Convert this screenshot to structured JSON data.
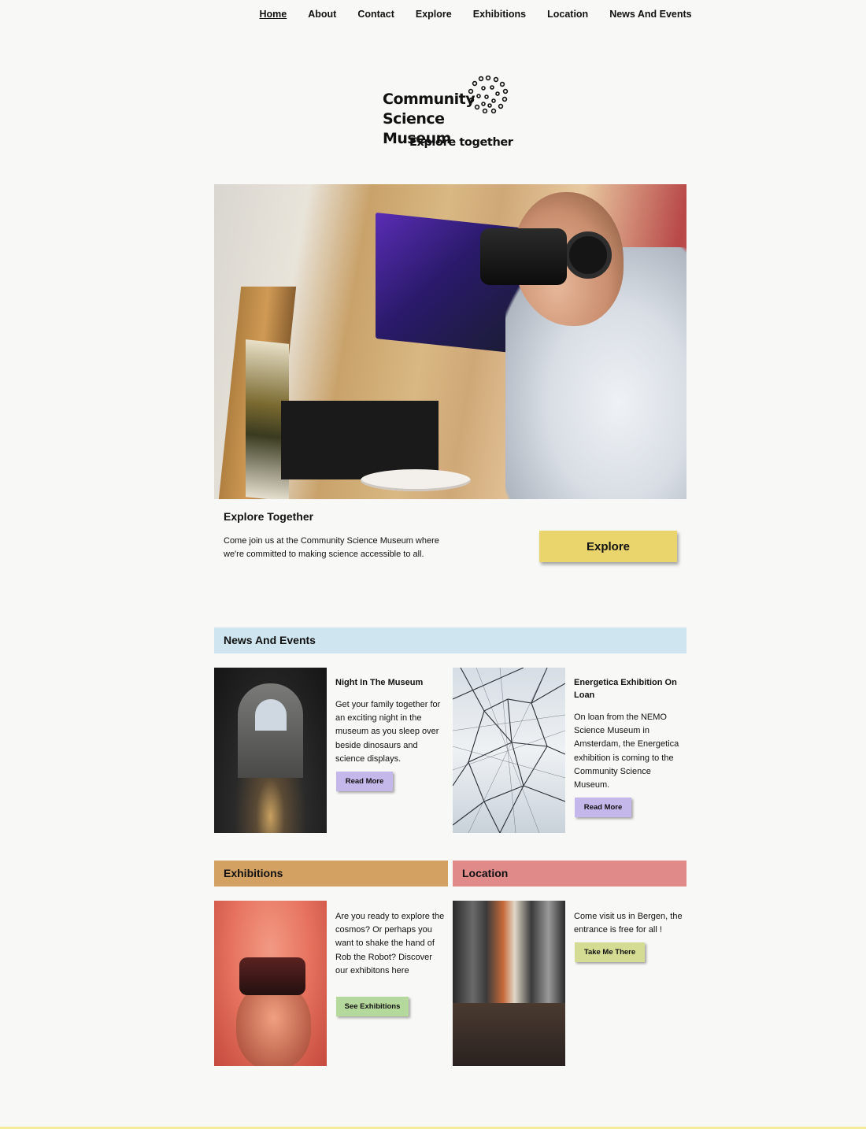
{
  "nav": {
    "items": [
      "Home",
      "About",
      "Contact",
      "Explore",
      "Exhibitions",
      "Location",
      "News And Events"
    ],
    "active": "Home"
  },
  "brand": {
    "name_line1": "Community",
    "name_line2": "Science Museum",
    "tagline": "Explore together"
  },
  "hero": {
    "title": "Explore Together",
    "text": "Come join us at the Community Science Museum where we're committed to making science accessible to all.",
    "button": "Explore"
  },
  "news": {
    "heading": "News And Events",
    "items": [
      {
        "title": "Night In The Museum",
        "text": "Get your family together for an exciting night in the museum as you sleep over beside dinosaurs and science displays.",
        "button": "Read More"
      },
      {
        "title": "Energetica Exhibition On Loan",
        "text": "On loan from the NEMO Science Museum in Amsterdam, the Energetica exhibition is coming to the Community Science Museum.",
        "button": "Read More"
      }
    ]
  },
  "exhibitions": {
    "heading": "Exhibitions",
    "text": "Are you ready to explore the cosmos? Or perhaps you want to shake the hand of Rob the Robot? Discover our exhibitons here",
    "button": "See Exhibitions"
  },
  "location": {
    "heading": "Location",
    "text": "Come visit us in Bergen, the entrance is free for all !",
    "button": "Take Me There"
  },
  "colors": {
    "background": "#f8f8f6",
    "explore_button": "#ead46c",
    "news_header": "#cfe5ef",
    "exhibitions_header": "#d3a263",
    "location_header": "#e08a8a",
    "read_more_button": "#c4b7ea",
    "see_exhibitions_button": "#b5d99c",
    "take_me_there_button": "#d3dc92"
  },
  "icons": {
    "logo": "virus-molecule-icon"
  }
}
